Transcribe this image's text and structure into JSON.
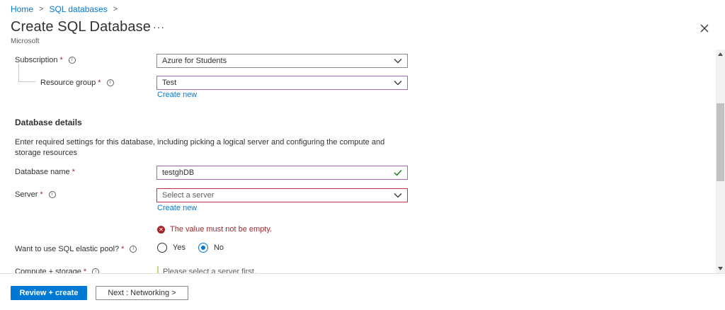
{
  "breadcrumb": [
    {
      "label": "Home"
    },
    {
      "label": "SQL databases"
    }
  ],
  "header": {
    "title": "Create SQL Database",
    "more_label": "···",
    "subtitle": "Microsoft"
  },
  "form": {
    "subscription": {
      "label": "Subscription",
      "required": "*",
      "value": "Azure for Students"
    },
    "resource_group": {
      "label": "Resource group",
      "required": "*",
      "value": "Test",
      "create_new": "Create new"
    },
    "database_details": {
      "title": "Database details",
      "description": "Enter required settings for this database, including picking a logical server and configuring the compute and storage resources"
    },
    "database_name": {
      "label": "Database name",
      "required": "*",
      "value": "testghDB"
    },
    "server": {
      "label": "Server",
      "required": "*",
      "placeholder": "Select a server",
      "create_new": "Create new",
      "error": "The value must not be empty."
    },
    "elastic_pool": {
      "label": "Want to use SQL elastic pool?",
      "required": "*",
      "options": [
        "Yes",
        "No"
      ],
      "selected": "No"
    },
    "compute_storage": {
      "label": "Compute + storage",
      "required": "*",
      "hint": "Please select a server first."
    }
  },
  "footer": {
    "primary_label": "Review + create",
    "secondary_label": "Next : Networking >"
  },
  "colors": {
    "accent": "#0078d4",
    "error": "#a4262c",
    "valid": "#107c10"
  },
  "icons": {
    "close": "close-icon",
    "info": "info-icon",
    "chevron": "chevron-down-icon",
    "check": "checkmark-icon",
    "error": "error-circle-icon"
  }
}
